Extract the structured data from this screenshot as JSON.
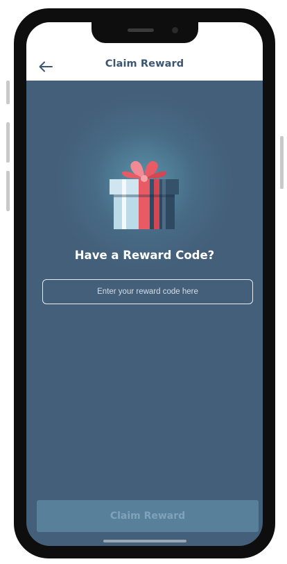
{
  "header": {
    "title": "Claim Reward",
    "back_icon": "arrow-left-icon"
  },
  "main": {
    "illustration_icon": "gift-box-icon",
    "heading": "Have a Reward Code?",
    "code_input": {
      "value": "",
      "placeholder": "Enter your reward code here"
    },
    "claim_button": {
      "label": "Claim Reward",
      "enabled": false
    }
  },
  "colors": {
    "background": "#445f79",
    "header_background": "#ffffff",
    "title_text": "#3c5672",
    "button_disabled_bg": "#58809b",
    "button_disabled_text": "#7fa3b8",
    "gift_ribbon": "#e85a64",
    "gift_box_light": "#cfe6f1",
    "gift_box_dark": "#36526b"
  }
}
